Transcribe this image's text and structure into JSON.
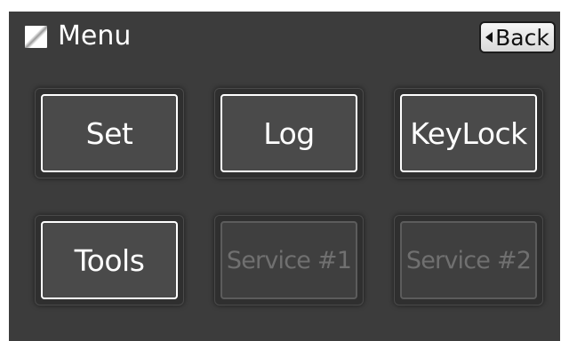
{
  "header": {
    "title": "Menu",
    "menu_icon": "menu-square-icon",
    "back_label": "Back",
    "back_icon": "triangle-left-icon"
  },
  "tiles": [
    {
      "label": "Set",
      "enabled": true
    },
    {
      "label": "Log",
      "enabled": true
    },
    {
      "label": "KeyLock",
      "enabled": true
    },
    {
      "label": "Tools",
      "enabled": true
    },
    {
      "label": "Service #1",
      "enabled": false
    },
    {
      "label": "Service #2",
      "enabled": false
    }
  ],
  "colors": {
    "screen_background": "#3c3c3c",
    "tile_border_active": "#ffffff",
    "tile_text_active": "#ffffff",
    "tile_text_disabled": "#707070",
    "back_button_background": "#e6e6e6"
  }
}
